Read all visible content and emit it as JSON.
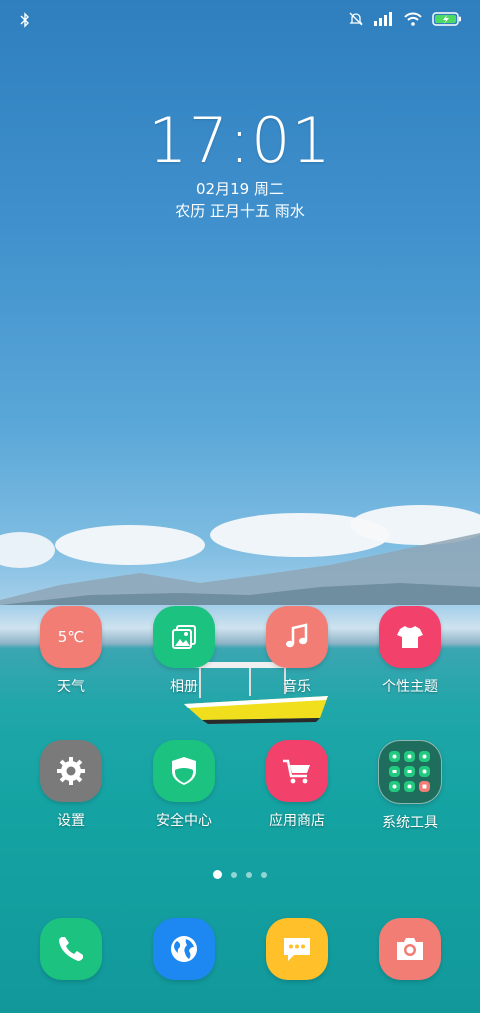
{
  "status_bar": {
    "left_icons": [
      "bluetooth-icon"
    ],
    "right_icons": [
      "silent-bell-icon",
      "signal-icon",
      "wifi-icon",
      "battery-charging-icon"
    ]
  },
  "lockscreen": {
    "time": "17:01",
    "date": "02月19 周二",
    "lunar": "农历 正月十五 雨水"
  },
  "home": {
    "row1": [
      {
        "label": "天气",
        "icon": "weather-icon",
        "icon_text": "5℃",
        "color": "#f27d74"
      },
      {
        "label": "相册",
        "icon": "gallery-icon",
        "color": "#1cc27f"
      },
      {
        "label": "音乐",
        "icon": "music-icon",
        "color": "#f27d74"
      },
      {
        "label": "个性主题",
        "icon": "theme-icon",
        "color": "#f2416a"
      }
    ],
    "row2": [
      {
        "label": "设置",
        "icon": "gear-icon",
        "color": "#7a7a7a"
      },
      {
        "label": "安全中心",
        "icon": "shield-icon",
        "color": "#1cc27f"
      },
      {
        "label": "应用商店",
        "icon": "store-cart-icon",
        "color": "#f2416a"
      },
      {
        "label": "系统工具",
        "icon": "folder-icon",
        "color": "#1f6d5c"
      }
    ],
    "page_indicator": {
      "pages": 4,
      "current": 1
    }
  },
  "dock": [
    {
      "icon": "phone-icon",
      "color": "#1cc27f"
    },
    {
      "icon": "browser-globe-icon",
      "color": "#1e88f2"
    },
    {
      "icon": "messages-icon",
      "color": "#ffc02a"
    },
    {
      "icon": "camera-icon",
      "color": "#f27d74"
    }
  ]
}
